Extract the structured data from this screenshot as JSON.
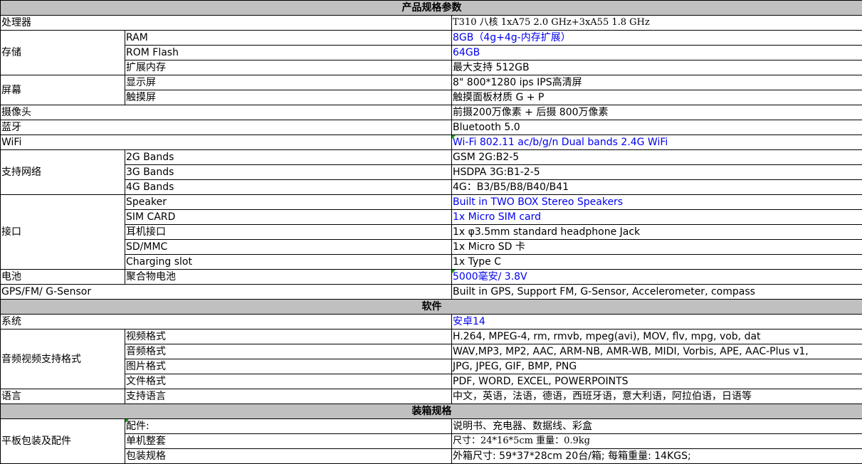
{
  "sections": {
    "product": "产品规格参数",
    "software": "软件",
    "packing": "装箱规格"
  },
  "rows": {
    "cpu": {
      "label": "处理器",
      "value": "T310 八核  1xA75 2.0 GHz+3xA55 1.8 GHz"
    },
    "storage": {
      "label": "存储",
      "ram": {
        "label": "RAM",
        "value": "8GB（4g+4g-内存扩展）"
      },
      "rom": {
        "label": "ROM Flash",
        "value": "64GB"
      },
      "ext": {
        "label": "扩展内存",
        "value": "最大支持 512GB"
      }
    },
    "screen": {
      "label": "屏幕",
      "display": {
        "label": "显示屏",
        "value": "8\" 800*1280 ips  IPS高清屏"
      },
      "touch": {
        "label": "触摸屏",
        "value": "触摸面板材质 G + P"
      }
    },
    "camera": {
      "label": "摄像头",
      "value": "前摄200万像素 + 后摄 800万像素"
    },
    "bluetooth": {
      "label": "蓝牙",
      "value": "Bluetooth 5.0"
    },
    "wifi": {
      "label": "WiFi",
      "value": "Wi-Fi 802.11 ac/b/g/n  Dual bands 2.4G WiFi"
    },
    "network": {
      "label": "支持网络",
      "g2": {
        "label": "2G Bands",
        "value": "GSM 2G:B2-5"
      },
      "g3": {
        "label": "3G Bands",
        "value": "HSDPA 3G:B1-2-5"
      },
      "g4": {
        "label": "4G Bands",
        "value": "4G：B3/B5/B8/B40/B41"
      }
    },
    "ports": {
      "label": "接口",
      "speaker": {
        "label": "Speaker",
        "value": "Built in TWO BOX Stereo Speakers"
      },
      "sim": {
        "label": "SIM CARD",
        "value": "1x Micro SIM card"
      },
      "headphone": {
        "label": "耳机接口",
        "value": "1x φ3.5mm standard headphone Jack"
      },
      "sd": {
        "label": "SD/MMC",
        "value": "1x Micro SD 卡"
      },
      "charging": {
        "label": "Charging slot",
        "value": "1x Type C"
      }
    },
    "battery": {
      "label": "电池",
      "sub": "聚合物电池",
      "value": "5000毫安/ 3.8V"
    },
    "gps": {
      "label": "GPS/FM/ G-Sensor",
      "value": "Built in GPS, Support FM, G-Sensor, Accelerometer, compass"
    },
    "os": {
      "label": "系统",
      "value": "安卓14"
    },
    "media": {
      "label": "音频视频支持格式",
      "video": {
        "label": "视频格式",
        "value": "H.264, MPEG-4, rm, rmvb, mpeg(avi), MOV, flv, mpg, vob, dat"
      },
      "audio": {
        "label": "音频格式",
        "value": "WAV,MP3, MP2, AAC, ARM-NB, AMR-WB, MIDI, Vorbis, APE, AAC-Plus v1,"
      },
      "image": {
        "label": "图片格式",
        "value": "JPG, JPEG, GIF, BMP, PNG"
      },
      "doc": {
        "label": "文件格式",
        "value": "PDF, WORD, EXCEL, POWERPOINTS"
      }
    },
    "language": {
      "label": "语言",
      "sub": "支持语言",
      "value": "中文，英语，法语，德语，西班牙语，意大利语，阿拉伯语，日语等"
    },
    "package": {
      "label": "平板包装及配件",
      "accessories": {
        "label": "配件:",
        "value": "说明书、充电器、数据线、彩盒"
      },
      "unit": {
        "label": "单机整套",
        "value": "尺寸：24*16*5cm    重量：0.9kg"
      },
      "box": {
        "label": "包装规格",
        "value": "外箱尺寸: 59*37*28cm    20台/箱; 每箱重量: 14KGS;"
      }
    }
  },
  "colors": {
    "header_bg": "#c0c0c0",
    "link_blue": "#0000ee",
    "border": "#000000"
  }
}
